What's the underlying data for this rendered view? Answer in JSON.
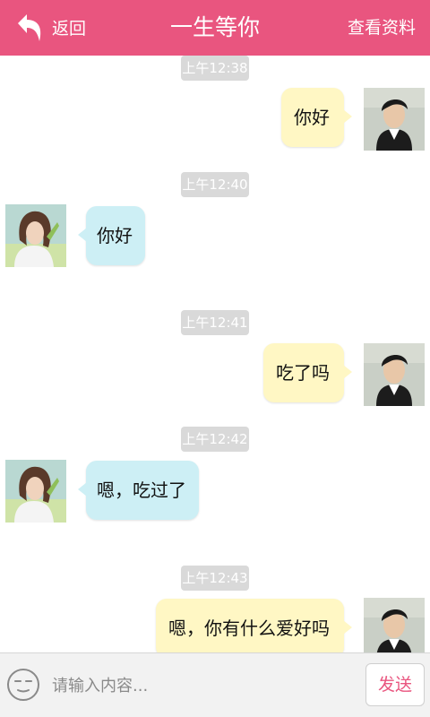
{
  "header": {
    "back_label": "返回",
    "title": "一生等你",
    "profile_label": "查看资料"
  },
  "messages": [
    {
      "time": "上午12:38",
      "side": "right",
      "text": "你好"
    },
    {
      "time": "上午12:40",
      "side": "left",
      "text": "你好"
    },
    {
      "time": "上午12:41",
      "side": "right",
      "text": "吃了吗"
    },
    {
      "time": "上午12:42",
      "side": "left",
      "text": "嗯，吃过了"
    },
    {
      "time": "上午12:43",
      "side": "right",
      "text": "嗯，你有什么爱好吗"
    }
  ],
  "input": {
    "placeholder": "请输入内容...",
    "value": "",
    "send_label": "发送"
  },
  "colors": {
    "header": "#e9557f",
    "bubble_self": "#fff7c4",
    "bubble_other": "#cdeff5",
    "timestamp_bg": "#d9d9d9",
    "send_text": "#e9557f"
  },
  "icons": {
    "back": "back-arrow-icon",
    "emoji": "smiley-face-icon"
  }
}
